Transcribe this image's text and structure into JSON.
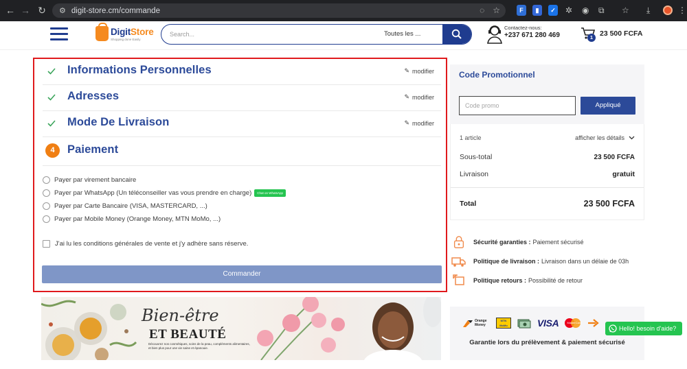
{
  "browser": {
    "url": "digit-store.cm/commande"
  },
  "header": {
    "logo_name_a": "Digit",
    "logo_name_b": "Store",
    "logo_tagline": "Shopping done Easily",
    "search_placeholder": "Search...",
    "search_category": "Toutes les ...",
    "contact_label": "Contactez-nous:",
    "contact_phone": "+237 671 280 469",
    "cart_count": "1",
    "cart_total": "23 500 FCFA"
  },
  "checkout": {
    "steps": [
      {
        "title": "Informations Personnelles",
        "edit": "modifier",
        "status": "done"
      },
      {
        "title": "Adresses",
        "edit": "modifier",
        "status": "done"
      },
      {
        "title": "Mode De Livraison",
        "edit": "modifier",
        "status": "done"
      },
      {
        "title": "Paiement",
        "number": "4",
        "status": "current"
      }
    ],
    "payment_options": [
      "Payer par virement bancaire",
      "Payer par WhatsApp (Un téléconseiller vas vous prendre en charge)",
      "Payer par Carte Bancaire (VISA, MASTERCARD, ...)",
      "Payer par Mobile Money (Orange Money, MTN MoMo, ...)"
    ],
    "whatsapp_chip": "Chat on WhatsApp",
    "terms_label": "J'ai lu les conditions générales de vente et j'y adhère sans réserve.",
    "order_button": "Commander"
  },
  "promo": {
    "title": "Code Promotionnel",
    "placeholder": "Code promo",
    "apply_button": "Appliqué"
  },
  "summary": {
    "items_count": "1 article",
    "details_toggle": "afficher les détails",
    "subtotal_label": "Sous-total",
    "subtotal_value": "23 500 FCFA",
    "shipping_label": "Livraison",
    "shipping_value": "gratuit",
    "total_label": "Total",
    "total_value": "23 500 FCFA"
  },
  "assurances": [
    {
      "title": "Sécurité garanties :",
      "text": "Paiement sécurisé",
      "icon": "lock-icon"
    },
    {
      "title": "Politique de livraison :",
      "text": "Livraison dans un délaie de 03h",
      "icon": "truck-icon"
    },
    {
      "title": "Politique retours :",
      "text": "Possibilité de retour",
      "icon": "return-icon"
    }
  ],
  "banner": {
    "title": "Bien-être",
    "subtitle": "ET BEAUTÉ",
    "description": "Découvrez nos cosmétiques, soins de la peau, compléments alimentaires, et bien plus pour une vie saine et épanouie."
  },
  "payment_logos": {
    "orange": "Orange Money",
    "mtn": "MTN MoMo",
    "visa": "VISA",
    "mastercard": "MasterCard",
    "guarantee": "Garantie lors du prélèvement & paiement sécurisé"
  },
  "whatsapp_float": "Hello! besoin d'aide?",
  "colors": {
    "primary": "#2c4a99",
    "accent": "#f07f13",
    "highlight_border": "#e0191c",
    "whatsapp": "#25c450"
  }
}
